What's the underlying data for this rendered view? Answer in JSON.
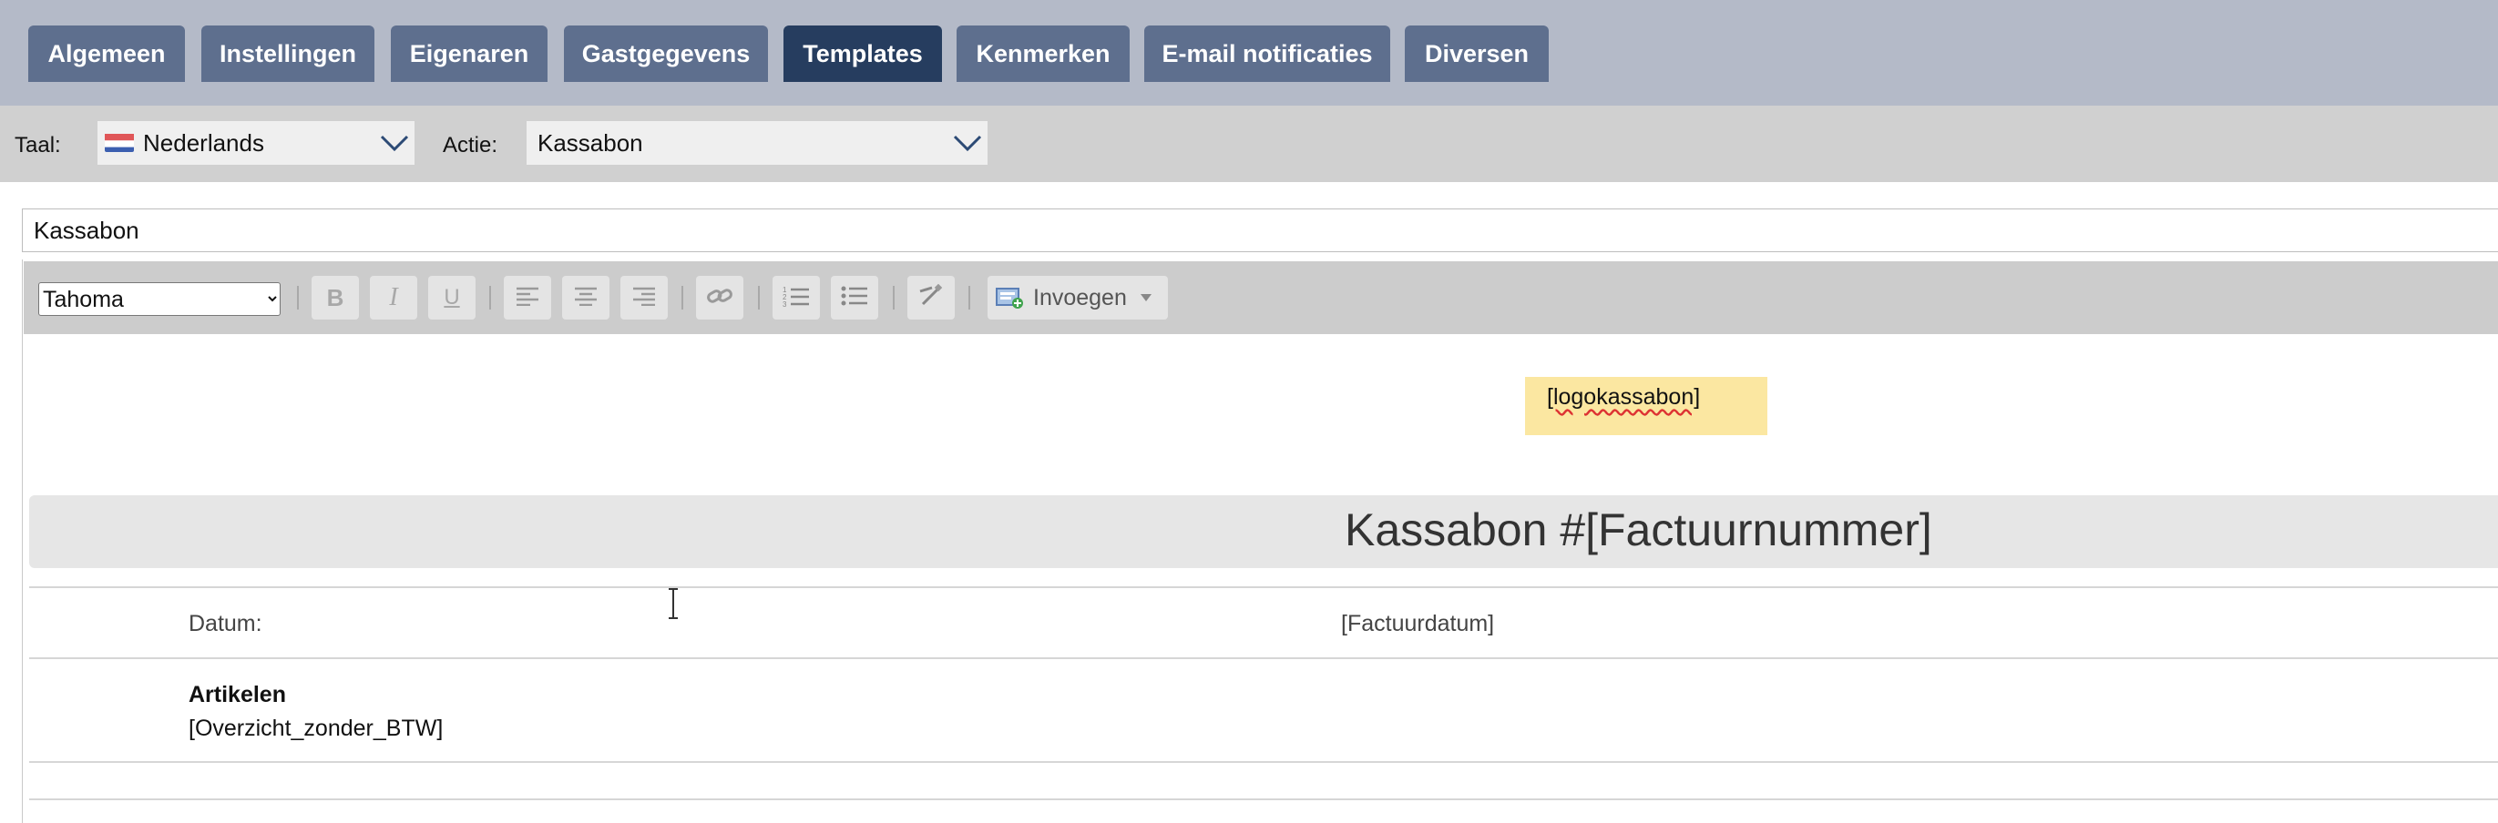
{
  "tabs": [
    {
      "label": "Algemeen",
      "active": false
    },
    {
      "label": "Instellingen",
      "active": false
    },
    {
      "label": "Eigenaren",
      "active": false
    },
    {
      "label": "Gastgegevens",
      "active": false
    },
    {
      "label": "Templates",
      "active": true
    },
    {
      "label": "Kenmerken",
      "active": false
    },
    {
      "label": "E-mail notificaties",
      "active": false
    },
    {
      "label": "Diversen",
      "active": false
    }
  ],
  "filters": {
    "language_label": "Taal:",
    "language_value": "Nederlands",
    "language_icon": "dutch-flag-icon",
    "action_label": "Actie:",
    "action_value": "Kassabon"
  },
  "template_title": "Kassabon",
  "editor": {
    "font": "Tahoma",
    "font_options": [
      "Tahoma"
    ],
    "insert_label": "Invoegen",
    "toolbar_icons": [
      "bold-icon",
      "italic-icon",
      "underline-icon",
      "align-left-icon",
      "align-center-icon",
      "align-right-icon",
      "link-icon",
      "numbered-list-icon",
      "bullet-list-icon",
      "clear-format-icon",
      "insert-icon"
    ]
  },
  "document": {
    "logo_placeholder": "[logokassabon]",
    "title": "Kassabon #[Factuurnummer]",
    "date_label": "Datum:",
    "date_value": "[Factuurdatum]",
    "articles_heading": "Artikelen",
    "articles_value": "[Overzicht_zonder_BTW]"
  },
  "colors": {
    "tab_bg": "#5e6f8e",
    "tab_active_bg": "#263d5f",
    "tabbar_bg": "#b4bac8",
    "placeholder_highlight": "#fbe7a1"
  }
}
